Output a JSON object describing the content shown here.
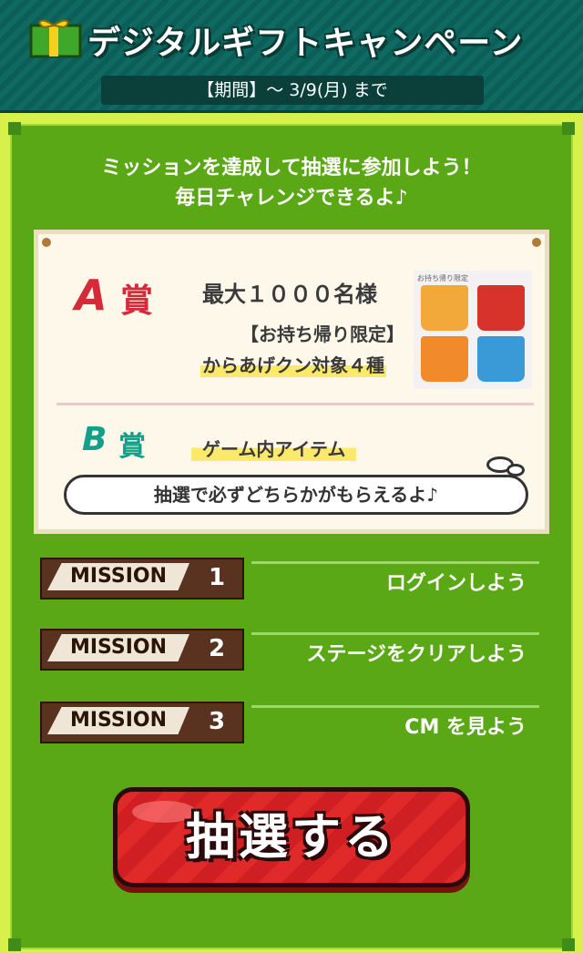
{
  "header": {
    "title": "デジタルギフトキャンペーン",
    "period": "【期間】～ 3/9(月) まで"
  },
  "intro": {
    "line1": "ミッションを達成して抽選に参加しよう！",
    "line2": "毎日チャレンジできるよ♪"
  },
  "prizes": {
    "a": {
      "letter": "A",
      "suffix": "賞",
      "count": "最大１０００名様",
      "limit": "【お持ち帰り限定】",
      "item": "からあげクン対象４種",
      "product_label": "お持ち帰り限定"
    },
    "b": {
      "letter": "B",
      "suffix": "賞",
      "item": "ゲーム内アイテム"
    },
    "note": "抽選で必ずどちらかがもらえるよ♪"
  },
  "missions": [
    {
      "label": "MISSION",
      "number": "1",
      "text": "ログインしよう"
    },
    {
      "label": "MISSION",
      "number": "2",
      "text": "ステージをクリアしよう"
    },
    {
      "label": "MISSION",
      "number": "3",
      "text": "CM を見よう"
    }
  ],
  "draw_button": {
    "label": "抽選する"
  },
  "colors": {
    "header_bg": "#0e6a62",
    "panel_green": "#5aa815",
    "accent_yellow": "#d8f04a",
    "prize_a_red": "#d62a3a",
    "prize_b_teal": "#13a08a",
    "mission_brown": "#5a3320",
    "button_red": "#e02a2a"
  },
  "icons": [
    "gift-icon"
  ]
}
